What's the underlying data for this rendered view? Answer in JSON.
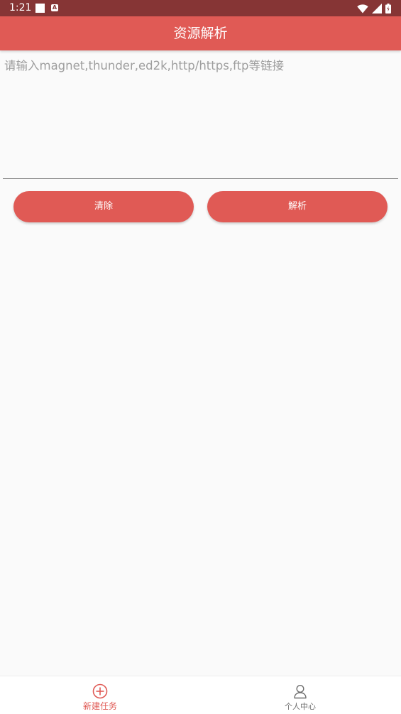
{
  "status_bar": {
    "time": "1:21",
    "icons": [
      "notification-square-icon",
      "a-box-icon",
      "wifi-icon",
      "signal-icon",
      "battery-icon"
    ]
  },
  "app_bar": {
    "title": "资源解析"
  },
  "input": {
    "value": "",
    "placeholder": "请输入magnet,thunder,ed2k,http/https,ftp等链接"
  },
  "buttons": {
    "clear_label": "清除",
    "parse_label": "解析"
  },
  "bottom_nav": {
    "items": [
      {
        "label": "新建任务",
        "icon": "add-circle-icon",
        "active": true
      },
      {
        "label": "个人中心",
        "icon": "person-icon",
        "active": false
      }
    ]
  },
  "colors": {
    "accent": "#e05a55",
    "status_bar": "#863535",
    "background": "#fafafa",
    "nav_inactive": "#6e6e6e"
  }
}
